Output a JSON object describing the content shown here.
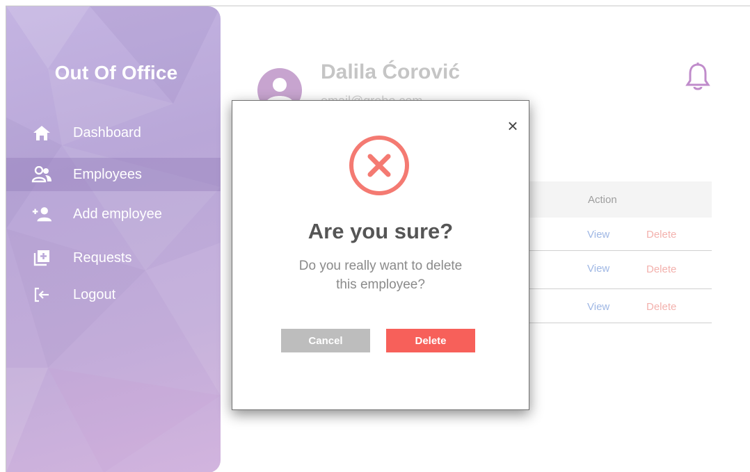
{
  "sidebar": {
    "brand": "Out Of Office",
    "items": [
      {
        "label": "Dashboard",
        "icon": "home-icon"
      },
      {
        "label": "Employees",
        "icon": "employees-icon",
        "active": true
      },
      {
        "label": "Add employee",
        "icon": "add-user-icon"
      },
      {
        "label": "Requests",
        "icon": "requests-icon"
      },
      {
        "label": "Logout",
        "icon": "logout-icon"
      }
    ]
  },
  "header": {
    "user_name": "Dalila Ćorović",
    "user_email": "email@grebo.com"
  },
  "table": {
    "action_header": "Action",
    "rows": [
      {
        "view": "View",
        "delete": "Delete"
      },
      {
        "view": "View",
        "delete": "Delete"
      },
      {
        "view": "View",
        "delete": "Delete"
      }
    ]
  },
  "modal": {
    "close": "×",
    "title": "Are you sure?",
    "text_line1": "Do you really  want to delete",
    "text_line2": "this employee?",
    "cancel_label": "Cancel",
    "delete_label": "Delete"
  },
  "colors": {
    "accent": "#f47a72",
    "delete_button": "#f7605a",
    "cancel_button": "#bdbdbd",
    "sidebar": "#bfaedd"
  }
}
